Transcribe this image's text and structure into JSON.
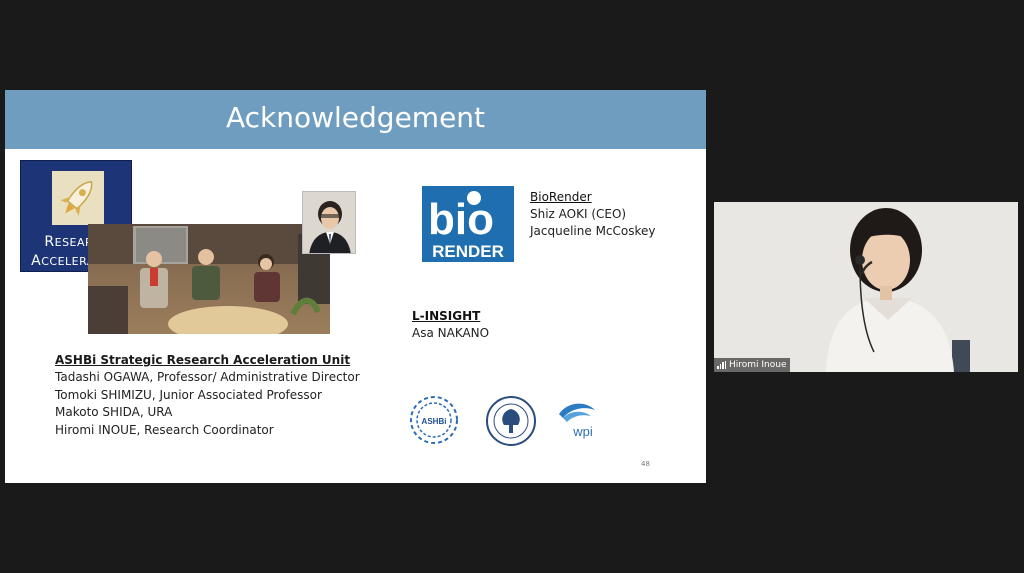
{
  "slide": {
    "title": "Acknowledgement",
    "page_number": "48",
    "research_acceleration_logo": {
      "line1_cap": "R",
      "line1_rest": "ESEARCH",
      "line2_cap": "A",
      "line2_rest": "CCELERATION"
    },
    "unit": {
      "title": "ASHBi Strategic Research Acceleration Unit",
      "members": [
        "Tadashi OGAWA, Professor/ Administrative Director",
        "Tomoki SHIMIZU, Junior Associated Professor",
        "Makoto SHIDA, URA",
        "Hiromi INOUE, Research Coordinator"
      ]
    },
    "biorender": {
      "logo_top": "bio",
      "logo_bottom": "RENDER",
      "title": "BioRender",
      "people": [
        "Shiz AOKI (CEO)",
        "Jacqueline McCoskey"
      ]
    },
    "linsight": {
      "title": "L-INSIGHT",
      "person": "Asa NAKANO"
    },
    "logos": {
      "ashbi": "ASHBi",
      "wpi": "wpi"
    }
  },
  "participant": {
    "name": "Hiromi Inoue"
  },
  "colors": {
    "background": "#1a1a1a",
    "slide_header": "#6f9dc0",
    "ra_logo_bg": "#1d3476",
    "biorender_blue": "#1f6fb0"
  }
}
